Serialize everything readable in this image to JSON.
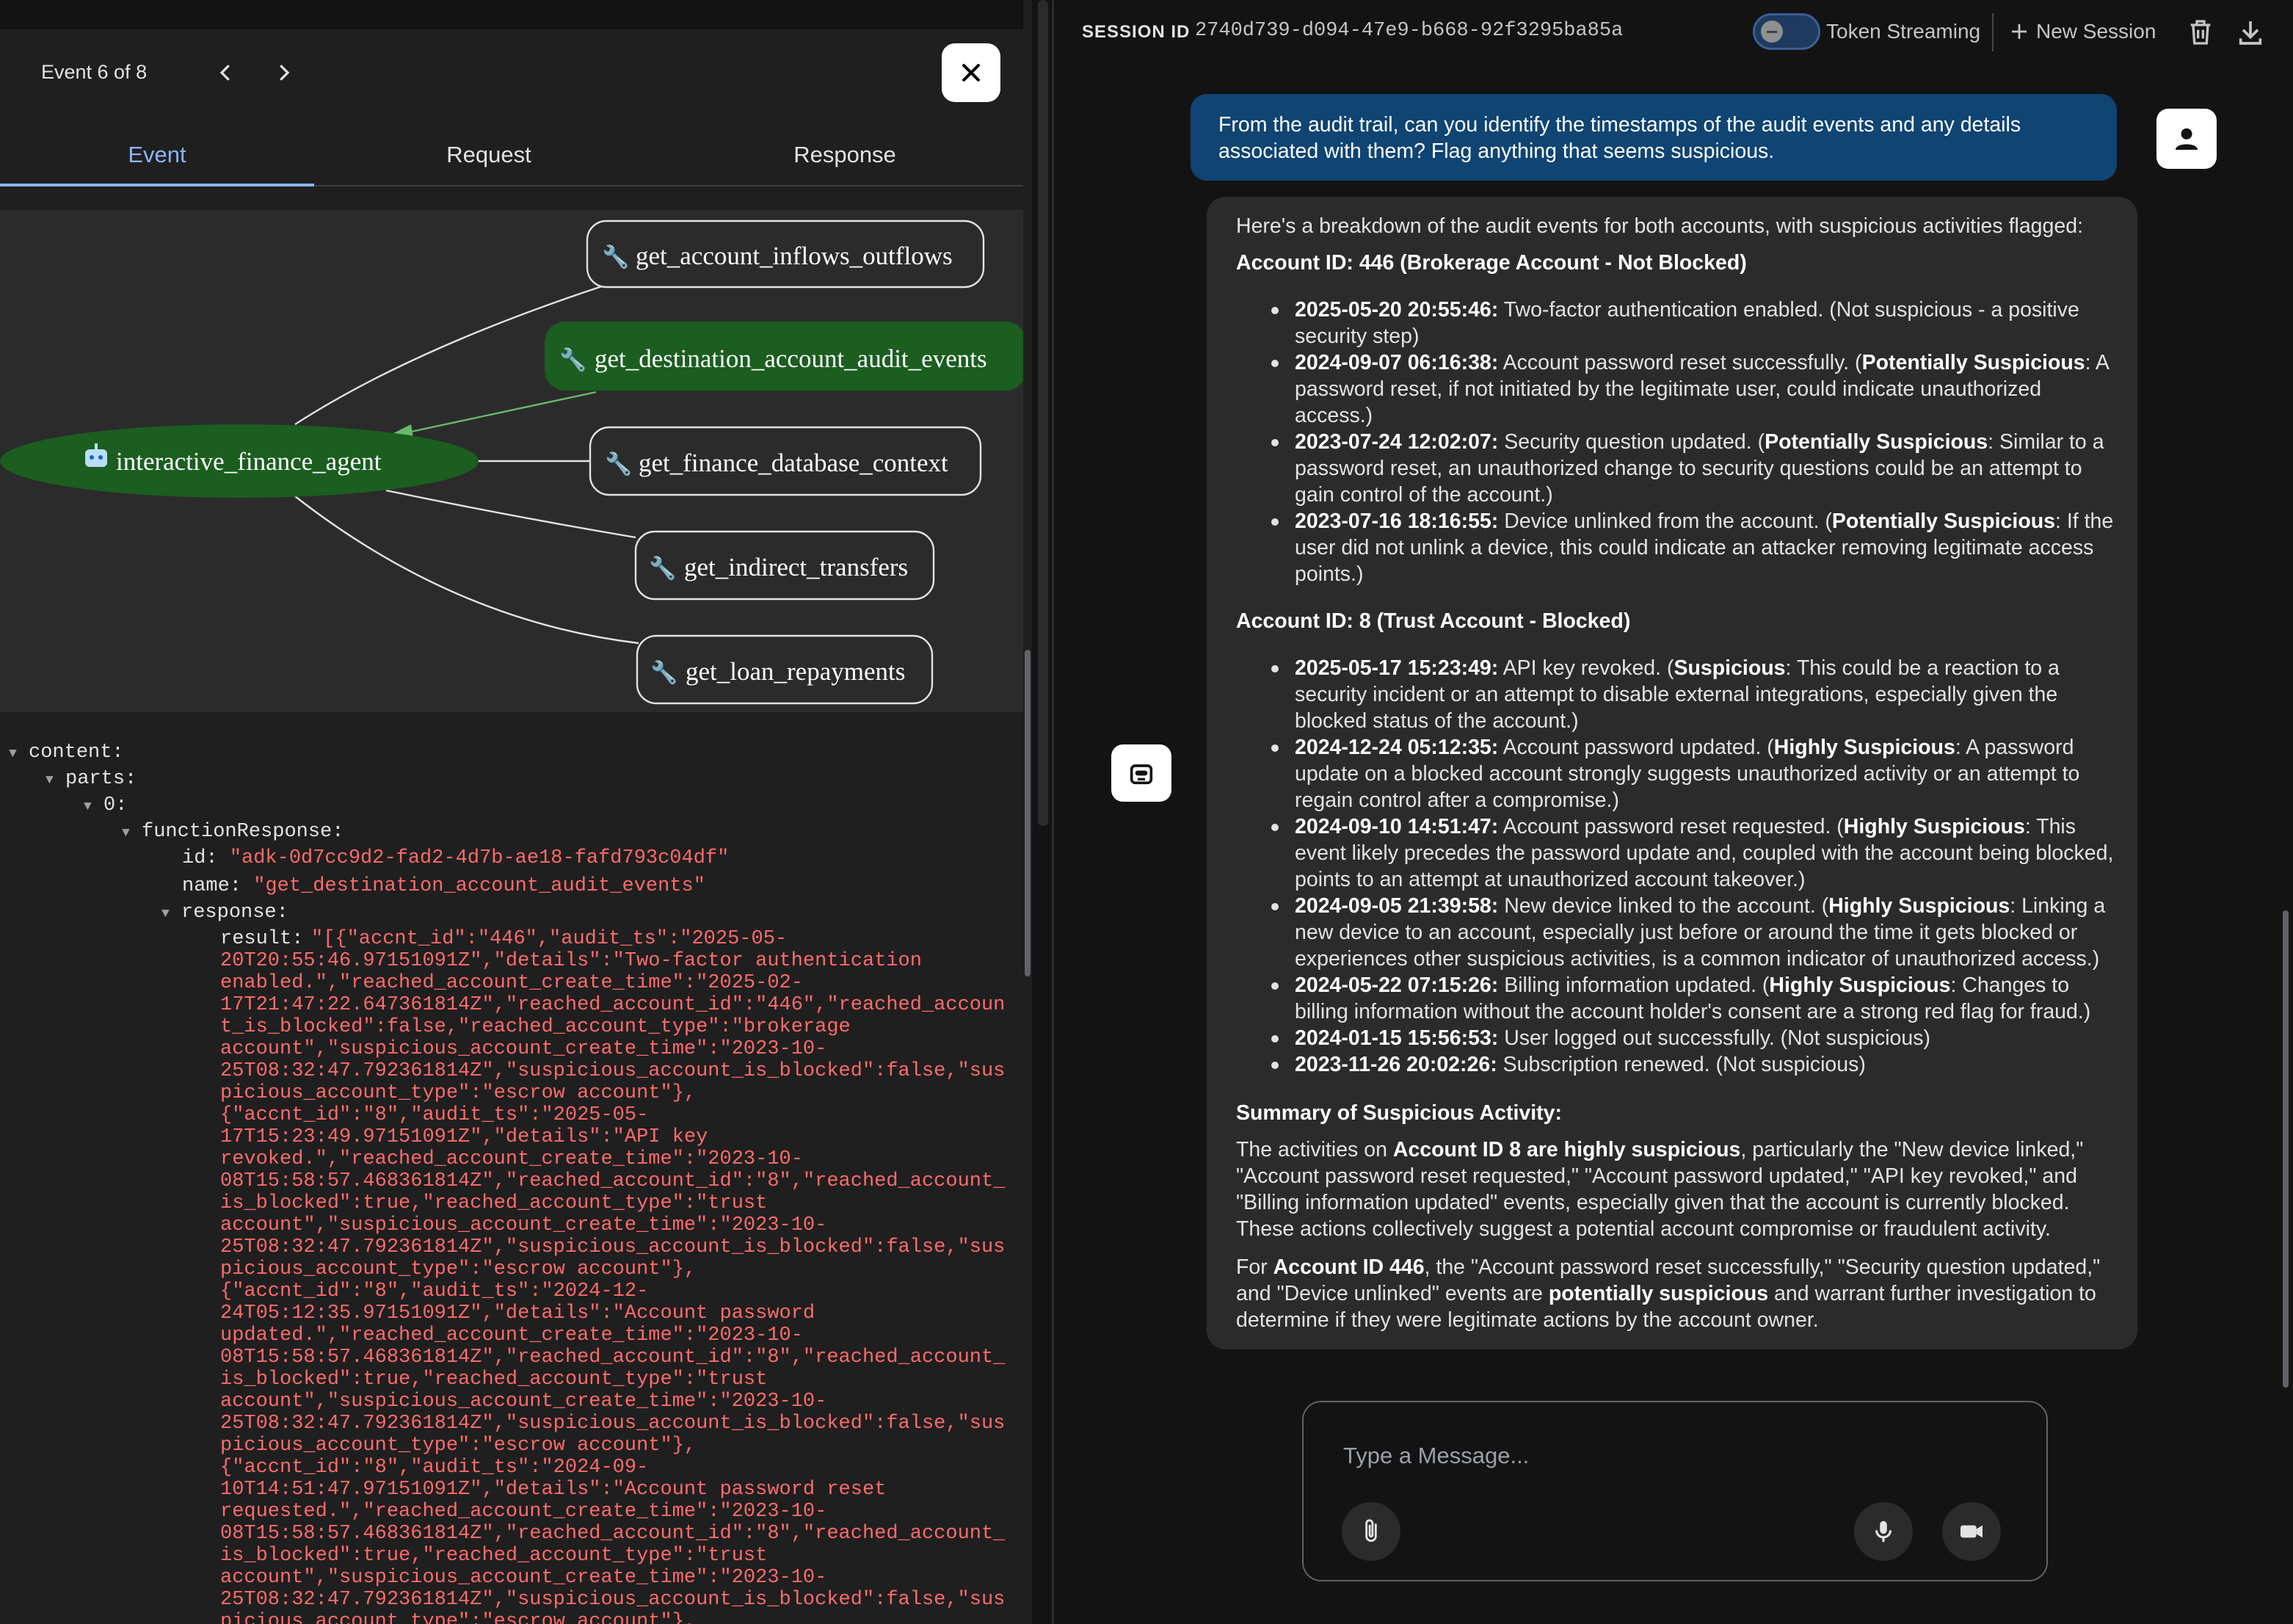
{
  "event_panel": {
    "counter": "Event 6 of 8",
    "tabs": [
      "Event",
      "Request",
      "Response"
    ],
    "active_tab": "Event",
    "graph": {
      "root": "interactive_finance_agent",
      "tools": [
        "get_account_inflows_outflows",
        "get_destination_account_audit_events",
        "get_finance_database_context",
        "get_indirect_transfers",
        "get_loan_repayments"
      ],
      "active_tool": "get_destination_account_audit_events",
      "node_color": "#1b5e20"
    },
    "json": {
      "content": "content:",
      "parts": "parts:",
      "index": "0:",
      "functionResponse": "functionResponse:",
      "id_key": "id:",
      "id_val": "\"adk-0d7cc9d2-fad2-4d7b-ae18-fafd793c04df\"",
      "name_key": "name:",
      "name_val": "\"get_destination_account_audit_events\"",
      "response_key": "response:",
      "result_key": "result:",
      "result_lines": [
        "\"[{\"accnt_id\":\"446\",\"audit_ts\":\"2025-05-",
        "20T20:55:46.97151091Z\",\"details\":\"Two-factor authentication",
        "enabled.\",\"reached_account_create_time\":\"2025-02-",
        "17T21:47:22.647361814Z\",\"reached_account_id\":\"446\",\"reached_accoun",
        "t_is_blocked\":false,\"reached_account_type\":\"brokerage",
        "account\",\"suspicious_account_create_time\":\"2023-10-",
        "25T08:32:47.792361814Z\",\"suspicious_account_is_blocked\":false,\"sus",
        "picious_account_type\":\"escrow account\"},",
        "{\"accnt_id\":\"8\",\"audit_ts\":\"2025-05-",
        "17T15:23:49.97151091Z\",\"details\":\"API key",
        "revoked.\",\"reached_account_create_time\":\"2023-10-",
        "08T15:58:57.468361814Z\",\"reached_account_id\":\"8\",\"reached_account_",
        "is_blocked\":true,\"reached_account_type\":\"trust",
        "account\",\"suspicious_account_create_time\":\"2023-10-",
        "25T08:32:47.792361814Z\",\"suspicious_account_is_blocked\":false,\"sus",
        "picious_account_type\":\"escrow account\"},",
        "{\"accnt_id\":\"8\",\"audit_ts\":\"2024-12-",
        "24T05:12:35.97151091Z\",\"details\":\"Account password",
        "updated.\",\"reached_account_create_time\":\"2023-10-",
        "08T15:58:57.468361814Z\",\"reached_account_id\":\"8\",\"reached_account_",
        "is_blocked\":true,\"reached_account_type\":\"trust",
        "account\",\"suspicious_account_create_time\":\"2023-10-",
        "25T08:32:47.792361814Z\",\"suspicious_account_is_blocked\":false,\"sus",
        "picious_account_type\":\"escrow account\"},",
        "{\"accnt_id\":\"8\",\"audit_ts\":\"2024-09-",
        "10T14:51:47.97151091Z\",\"details\":\"Account password reset",
        "requested.\",\"reached_account_create_time\":\"2023-10-",
        "08T15:58:57.468361814Z\",\"reached_account_id\":\"8\",\"reached_account_",
        "is_blocked\":true,\"reached_account_type\":\"trust",
        "account\",\"suspicious_account_create_time\":\"2023-10-",
        "25T08:32:47.792361814Z\",\"suspicious_account_is_blocked\":false,\"sus",
        "picious_account_type\":\"escrow account\"},"
      ]
    }
  },
  "session_bar": {
    "label": "SESSION ID",
    "id": "2740d739-d094-47e9-b668-92f3295ba85a",
    "streaming_label": "Token Streaming",
    "streaming_on": false,
    "new_session": "New Session"
  },
  "chat": {
    "user_message": "From the audit trail, can you identify the timestamps of the audit events and any details associated with them? Flag anything that seems suspicious.",
    "bot": {
      "intro": "Here's a breakdown of the audit events for both accounts, with suspicious activities flagged:",
      "account1_title": "Account ID: 446 (Brokerage Account - Not Blocked)",
      "account1_items": [
        {
          "ts": "2025-05-20 20:55:46:",
          "pre": "Two-factor authentication enabled. (Not suspicious - a positive security step)",
          "flag": "",
          "post": ""
        },
        {
          "ts": "2024-09-07 06:16:38:",
          "pre": "Account password reset successfully. (",
          "flag": "Potentially Suspicious",
          "post": ": A password reset, if not initiated by the legitimate user, could indicate unauthorized access.)"
        },
        {
          "ts": "2023-07-24 12:02:07:",
          "pre": "Security question updated. (",
          "flag": "Potentially Suspicious",
          "post": ": Similar to a password reset, an unauthorized change to security questions could be an attempt to gain control of the account.)"
        },
        {
          "ts": "2023-07-16 18:16:55:",
          "pre": "Device unlinked from the account. (",
          "flag": "Potentially Suspicious",
          "post": ": If the user did not unlink a device, this could indicate an attacker removing legitimate access points.)"
        }
      ],
      "account2_title": "Account ID: 8 (Trust Account - Blocked)",
      "account2_items": [
        {
          "ts": "2025-05-17 15:23:49:",
          "pre": "API key revoked. (",
          "flag": "Suspicious",
          "post": ": This could be a reaction to a security incident or an attempt to disable external integrations, especially given the blocked status of the account.)"
        },
        {
          "ts": "2024-12-24 05:12:35:",
          "pre": "Account password updated. (",
          "flag": "Highly Suspicious",
          "post": ": A password update on a blocked account strongly suggests unauthorized activity or an attempt to regain control after a compromise.)"
        },
        {
          "ts": "2024-09-10 14:51:47:",
          "pre": "Account password reset requested. (",
          "flag": "Highly Suspicious",
          "post": ": This event likely precedes the password update and, coupled with the account being blocked, points to an attempt at unauthorized account takeover.)"
        },
        {
          "ts": "2024-09-05 21:39:58:",
          "pre": "New device linked to the account. (",
          "flag": "Highly Suspicious",
          "post": ": Linking a new device to an account, especially just before or around the time it gets blocked or experiences other suspicious activities, is a common indicator of unauthorized access.)"
        },
        {
          "ts": "2024-05-22 07:15:26:",
          "pre": "Billing information updated. (",
          "flag": "Highly Suspicious",
          "post": ": Changes to billing information without the account holder's consent are a strong red flag for fraud.)"
        },
        {
          "ts": "2024-01-15 15:56:53:",
          "pre": "User logged out successfully. (Not suspicious)",
          "flag": "",
          "post": ""
        },
        {
          "ts": "2023-11-26 20:02:26:",
          "pre": "Subscription renewed. (Not suspicious)",
          "flag": "",
          "post": ""
        }
      ],
      "summary_title": "Summary of Suspicious Activity:",
      "summary1": {
        "pre": "The activities on ",
        "bold": "Account ID 8 are highly suspicious",
        "post": ", particularly the \"New device linked,\" \"Account password reset requested,\" \"Account password updated,\" \"API key revoked,\" and \"Billing information updated\" events, especially given that the account is currently blocked. These actions collectively suggest a potential account compromise or fraudulent activity."
      },
      "summary2": {
        "pre": "For ",
        "bold1": "Account ID 446",
        "mid": ", the \"Account password reset successfully,\" \"Security question updated,\" and \"Device unlinked\" events are ",
        "bold2": "potentially suspicious",
        "post": " and warrant further investigation to determine if they were legitimate actions by the account owner."
      }
    },
    "composer_placeholder": "Type a Message..."
  }
}
